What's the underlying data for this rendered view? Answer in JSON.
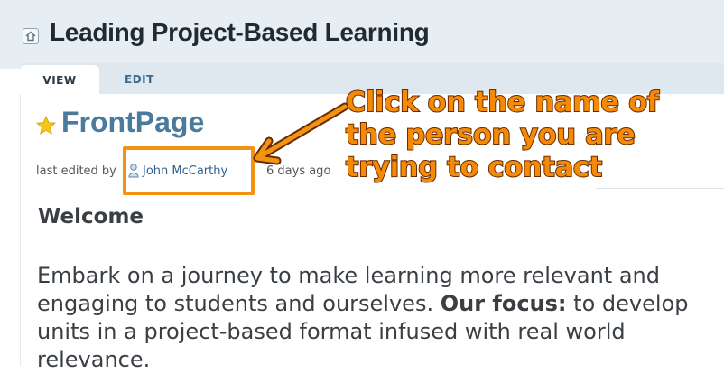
{
  "header": {
    "title": "Leading Project-Based Learning",
    "home_icon": "home-icon"
  },
  "tabs": [
    {
      "label": "VIEW",
      "active": true
    },
    {
      "label": "EDIT",
      "active": false
    }
  ],
  "page": {
    "title": "FrontPage",
    "title_icon": "star-icon",
    "meta": {
      "prefix": "last edited by",
      "author": "John McCarthy",
      "author_icon": "user-icon",
      "suffix": "6 days ago"
    },
    "heading": "Welcome",
    "body_before_bold": "Embark on a journey to make learning more relevant and engaging to students and ourselves. ",
    "body_bold": "Our focus:",
    "body_after_bold": " to develop units in a project-based format infused with real world relevance."
  },
  "annotation": {
    "lines": [
      "Click on the name of",
      "the person you are",
      "trying to contact"
    ],
    "color": "#f58a07",
    "outline_color": "#6a2a00",
    "highlight_color": "#f39313"
  }
}
